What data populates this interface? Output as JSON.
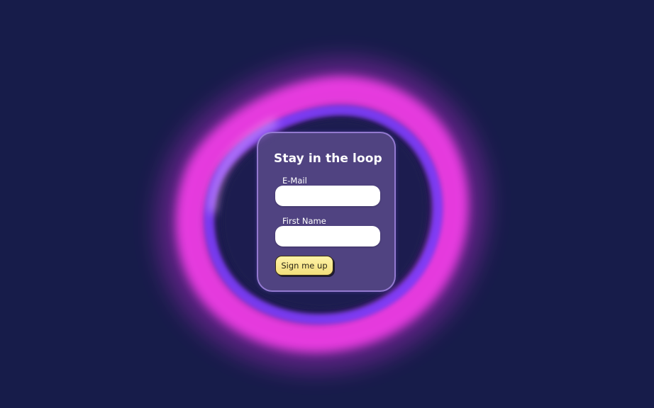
{
  "colors": {
    "background": "#171c4a",
    "ring_pink": "#f23ce6",
    "ring_violet": "#8b3cff",
    "card_fill": "#5c4c8c",
    "card_border": "#aa8ceb",
    "button_fill": "#f8ea8f"
  },
  "form": {
    "title": "Stay in the loop",
    "email": {
      "label": "E-Mail",
      "value": "",
      "placeholder": ""
    },
    "first_name": {
      "label": "First Name",
      "value": "",
      "placeholder": ""
    },
    "submit_label": "Sign me up"
  },
  "decor": {
    "ring": "glowing-ring"
  }
}
